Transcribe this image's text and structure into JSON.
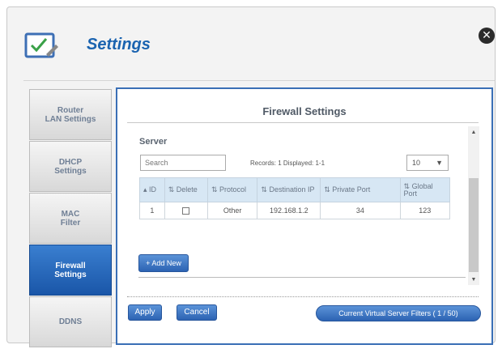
{
  "window": {
    "title": "Settings",
    "close_label": "✕"
  },
  "sidebar": {
    "items": [
      {
        "label": "Router\nLAN Settings",
        "active": false
      },
      {
        "label": "DHCP\nSettings",
        "active": false
      },
      {
        "label": "MAC\nFilter",
        "active": false
      },
      {
        "label": "Firewall\nSettings",
        "active": true
      },
      {
        "label": "DDNS",
        "active": false
      }
    ]
  },
  "main": {
    "title": "Firewall Settings",
    "section_label": "Server",
    "search": {
      "placeholder": "Search",
      "value": ""
    },
    "records_text": "Records: 1  Displayed: 1-1",
    "page_size": "10",
    "table": {
      "headers": [
        "ID",
        "Delete",
        "Protocol",
        "Destination IP",
        "Private Port",
        "Global Port"
      ],
      "rows": [
        {
          "id": "1",
          "delete": false,
          "protocol": "Other",
          "destination_ip": "192.168.1.2",
          "private_port": "34",
          "global_port": "123"
        }
      ]
    },
    "add_button": "+ Add New",
    "footer": {
      "apply": "Apply",
      "cancel": "Cancel",
      "filters": "Current Virtual Server Filters ( 1 / 50)"
    }
  },
  "colors": {
    "accent": "#2c63b3",
    "title_blue": "#1a63b0",
    "header_bg": "#d7e7f4"
  },
  "icons": [
    "settings-checklist-icon",
    "close-icon",
    "sort-icon",
    "chevron-down-icon",
    "scroll-up-icon",
    "scroll-down-icon"
  ]
}
